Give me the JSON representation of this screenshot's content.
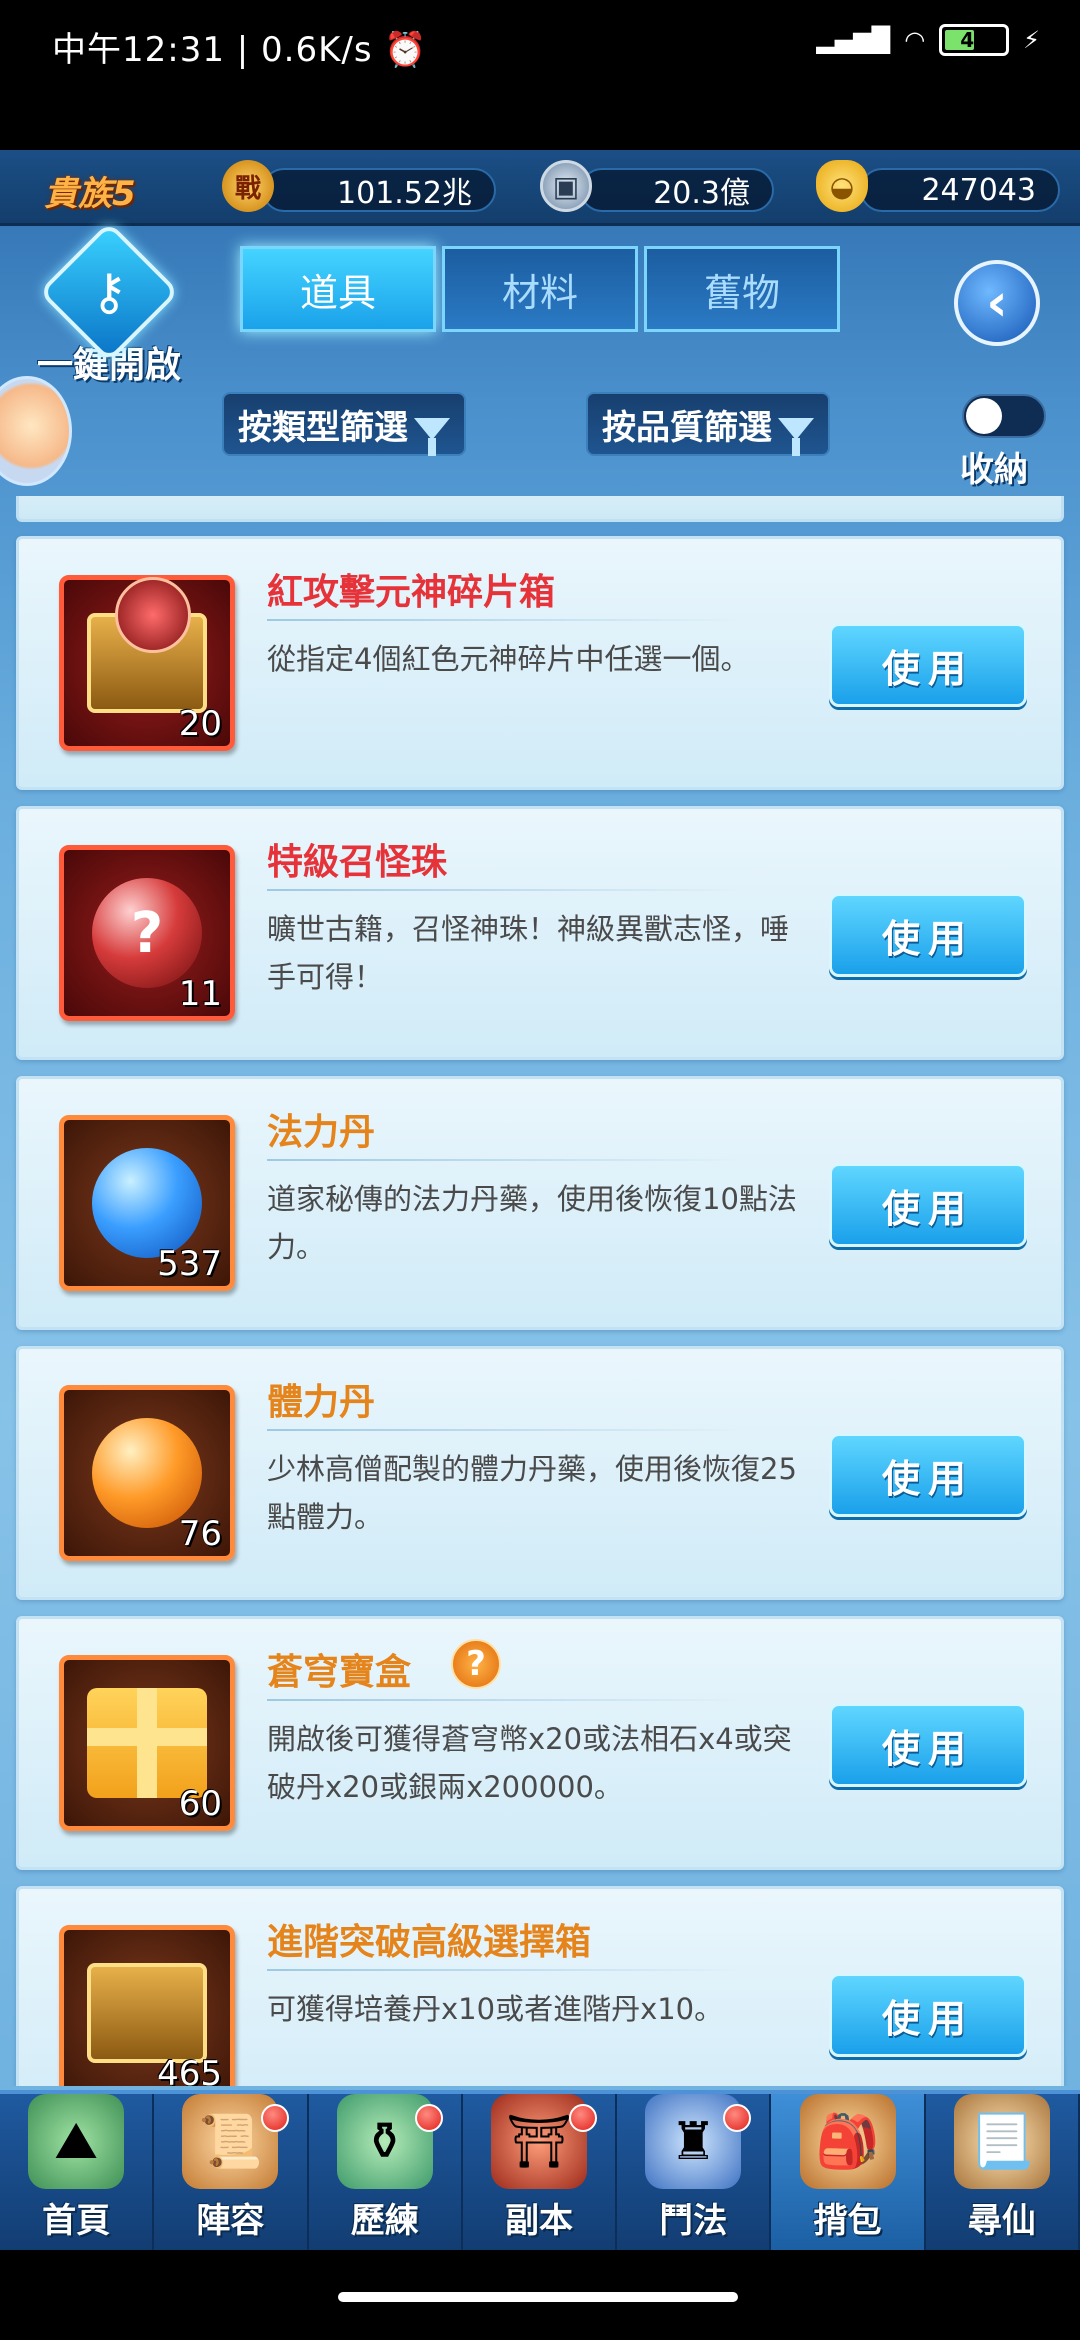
{
  "status_bar": {
    "left_text": "中午12:31 | 0.6K/s ⏰",
    "battery": "45"
  },
  "currency": {
    "vip": "貴族5",
    "power_icon": "戰",
    "power_value": "101.52兆",
    "coin_value": "20.3億",
    "ingot_value": "247043"
  },
  "header": {
    "onekey_label": "一鍵開啟",
    "tabs": [
      {
        "label": "道具",
        "active": true
      },
      {
        "label": "材料",
        "active": false
      },
      {
        "label": "舊物",
        "active": false
      }
    ],
    "filter_type": "按類型篩選",
    "filter_quality": "按品質篩選",
    "toggle_label": "收納"
  },
  "items": [
    {
      "name": "紅攻擊元神碎片箱",
      "desc": "從指定4個紅色元神碎片中任選一個。",
      "count": "20",
      "use": "使用",
      "quality": "red",
      "icon": "chest-red-icon"
    },
    {
      "name": "特級召怪珠",
      "desc": "曠世古籍，召怪神珠！神級異獸志怪，唾手可得！",
      "count": "11",
      "use": "使用",
      "quality": "red",
      "icon": "summon-orb-icon"
    },
    {
      "name": "法力丹",
      "desc": "道家秘傳的法力丹藥，使用後恢復10點法力。",
      "count": "537",
      "use": "使用",
      "quality": "orange",
      "icon": "blue-pill-icon"
    },
    {
      "name": "體力丹",
      "desc": "少林高僧配製的體力丹藥，使用後恢復25點體力。",
      "count": "76",
      "use": "使用",
      "quality": "orange",
      "icon": "orange-pill-icon"
    },
    {
      "name": "蒼穹寶盒",
      "desc": "開啟後可獲得蒼穹幣x20或法相石x4或突破丹x20或銀兩x200000。",
      "count": "60",
      "use": "使用",
      "quality": "orange",
      "icon": "gift-box-icon"
    },
    {
      "name": "進階突破高級選擇箱",
      "desc": "可獲得培養丹x10或者進階丹x10。",
      "count": "465",
      "use": "使用",
      "quality": "orange",
      "icon": "chest-orbs-icon"
    }
  ],
  "nav": [
    {
      "label": "首頁",
      "dot": false,
      "active": false
    },
    {
      "label": "陣容",
      "dot": true,
      "active": false
    },
    {
      "label": "歷練",
      "dot": true,
      "active": false
    },
    {
      "label": "副本",
      "dot": true,
      "active": false
    },
    {
      "label": "鬥法",
      "dot": true,
      "active": false
    },
    {
      "label": "揹包",
      "dot": false,
      "active": true
    },
    {
      "label": "尋仙",
      "dot": false,
      "active": false
    }
  ]
}
